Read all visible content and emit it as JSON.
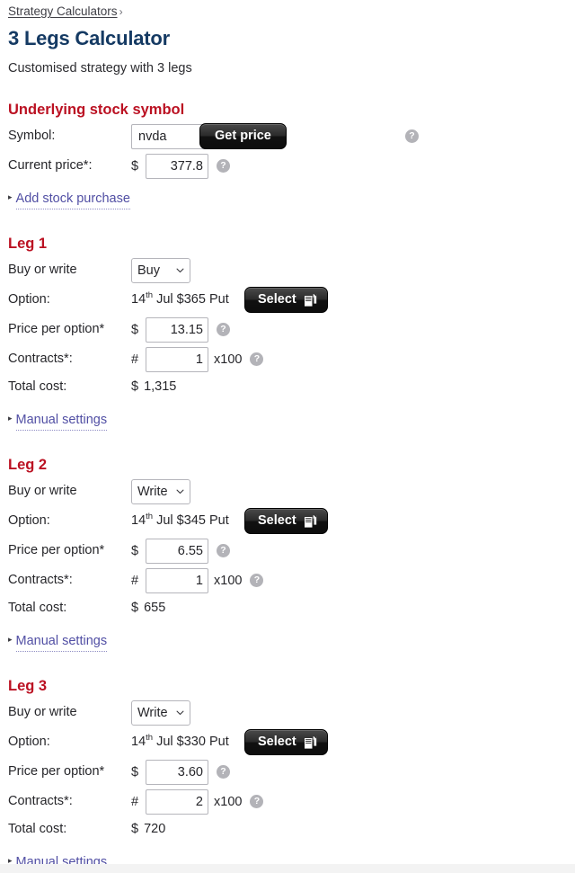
{
  "breadcrumb": {
    "parent": "Strategy Calculators",
    "separator": "›"
  },
  "header": {
    "title": "3 Legs Calculator",
    "subtitle": "Customised strategy with 3 legs"
  },
  "underlying": {
    "section_title": "Underlying stock symbol",
    "symbol_label": "Symbol:",
    "symbol_value": "nvda",
    "symbol_placeholder": "",
    "get_price_label": "Get price",
    "current_price_label": "Current price*:",
    "currency": "$",
    "current_price_value": "377.8",
    "help_glyph": "?",
    "add_stock_purchase": "Add stock purchase"
  },
  "common": {
    "buy_or_write_label": "Buy or write",
    "option_label": "Option:",
    "price_per_option_label": "Price per option*",
    "contracts_label": "Contracts*:",
    "total_cost_label": "Total cost:",
    "select_label": "Select",
    "manual_settings": "Manual settings",
    "currency": "$",
    "hash": "#",
    "multiplier": "x100",
    "help_glyph": "?",
    "expander_triangle": "▸",
    "buy_write_options": [
      "Buy",
      "Write"
    ]
  },
  "legs": [
    {
      "title": "Leg 1",
      "direction": "Buy",
      "option_day": "14",
      "option_ordinal": "th",
      "option_rest": "Jul $365 Put",
      "price_per_option": "13.15",
      "contracts": "1",
      "total_cost": "1,315"
    },
    {
      "title": "Leg 2",
      "direction": "Write",
      "option_day": "14",
      "option_ordinal": "th",
      "option_rest": "Jul $345 Put",
      "price_per_option": "6.55",
      "contracts": "1",
      "total_cost": "655"
    },
    {
      "title": "Leg 3",
      "direction": "Write",
      "option_day": "14",
      "option_ordinal": "th",
      "option_rest": "Jul $330 Put",
      "price_per_option": "3.60",
      "contracts": "2",
      "total_cost": "720"
    }
  ],
  "colors": {
    "title_blue": "#153a63",
    "section_red": "#bb1122",
    "link_purple": "#514fa4",
    "button_dark": "#111111"
  }
}
